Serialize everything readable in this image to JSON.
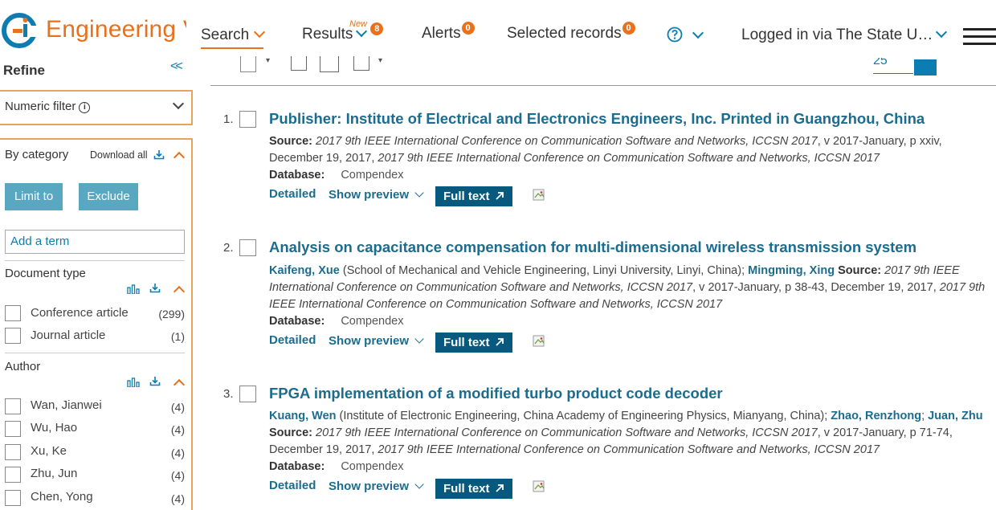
{
  "header": {
    "logo_text": "Engineering V",
    "brand_color": "#e9711c",
    "nav": {
      "search": "Search",
      "results": "Results",
      "results_new": "New",
      "results_badge": "8",
      "alerts": "Alerts",
      "alerts_badge": "0",
      "selected": "Selected records",
      "selected_badge": "0",
      "login": "Logged in via The State U…"
    }
  },
  "sidebar": {
    "refine": "Refine",
    "collapse": "<<",
    "numeric_filter": "Numeric filter",
    "by_category": "By category",
    "download_all": "Download all",
    "limit_to": "Limit to",
    "exclude": "Exclude",
    "add_term_placeholder": "Add a term",
    "document_type": {
      "title": "Document type",
      "items": [
        {
          "label": "Conference article",
          "count": "(299)"
        },
        {
          "label": "Journal article",
          "count": "(1)"
        }
      ]
    },
    "author": {
      "title": "Author",
      "items": [
        {
          "label": "Wan, Jianwei",
          "count": "(4)"
        },
        {
          "label": "Wu, Hao",
          "count": "(4)"
        },
        {
          "label": "Xu, Ke",
          "count": "(4)"
        },
        {
          "label": "Zhu, Jun",
          "count": "(4)"
        },
        {
          "label": "Chen, Yong",
          "count": "(4)"
        }
      ]
    }
  },
  "toolbar": {
    "per_page": "25"
  },
  "results": [
    {
      "num": "1.",
      "title": "Publisher: Institute of Electrical and Electronics Engineers, Inc. Printed in Guangzhou, China",
      "authors_html": "",
      "source_label": "Source:",
      "source_text": "2017 9th IEEE International Conference on Communication Software and Networks, ICCSN 2017",
      "source_mid": ", v 2017-January, p xxiv, December 19, 2017,",
      "source_tail": "2017 9th IEEE International Conference on Communication Software and Networks, ICCSN 2017",
      "database_label": "Database:",
      "database": "Compendex",
      "detailed": "Detailed",
      "show_preview": "Show preview",
      "full_text": "Full text"
    },
    {
      "num": "2.",
      "title": "Analysis on capacitance compensation for multi-dimensional wireless transmission system",
      "author1": "Kaifeng, Xue",
      "affil1": "(School of Mechanical and Vehicle Engineering, Linyi University, Linyi, China);",
      "author2": "Mingming, Xing",
      "source_label": "Source:",
      "source_text": "2017 9th IEEE International Conference on Communication Software and Networks, ICCSN 2017",
      "source_mid": ", v 2017-January, p 38-43, December 19, 2017,",
      "source_tail": "2017 9th IEEE International Conference on Communication Software and Networks, ICCSN 2017",
      "database_label": "Database:",
      "database": "Compendex",
      "detailed": "Detailed",
      "show_preview": "Show preview",
      "full_text": "Full text"
    },
    {
      "num": "3.",
      "title": "FPGA implementation of a modified turbo product code decoder",
      "author1": "Kuang, Wen",
      "affil1": "(Institute of Electronic Engineering, China Academy of Engineering Physics, Mianyang, China);",
      "author2": "Zhao, Renzhong",
      "author3": "Juan, Zhu",
      "source_label": "Source:",
      "source_text": "2017 9th IEEE International Conference on Communication Software and Networks, ICCSN 2017",
      "source_mid": ", v 2017-January, p 71-74, December 19, 2017,",
      "source_tail": "2017 9th IEEE International Conference on Communication Software and Networks, ICCSN 2017",
      "database_label": "Database:",
      "database": "Compendex",
      "detailed": "Detailed",
      "show_preview": "Show preview",
      "full_text": "Full text"
    }
  ]
}
